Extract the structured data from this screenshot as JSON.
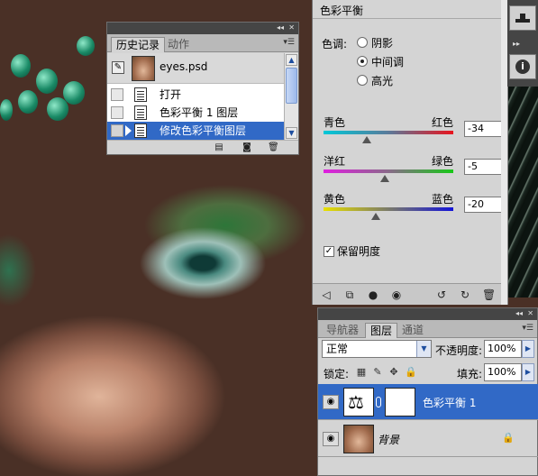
{
  "history_panel": {
    "tabs": [
      "历史记录",
      "动作"
    ],
    "snapshot_name": "eyes.psd",
    "states": [
      {
        "label": "打开",
        "selected": false
      },
      {
        "label": "色彩平衡 1 图层",
        "selected": false
      },
      {
        "label": "修改色彩平衡图层",
        "selected": true
      }
    ]
  },
  "color_balance_panel": {
    "title": "色彩平衡",
    "tone_label": "色调:",
    "tones": [
      {
        "label": "阴影",
        "selected": false
      },
      {
        "label": "中间调",
        "selected": true
      },
      {
        "label": "高光",
        "selected": false
      }
    ],
    "sliders": [
      {
        "left": "青色",
        "right": "红色",
        "value": "-34",
        "num": -34
      },
      {
        "left": "洋红",
        "right": "绿色",
        "value": "-5",
        "num": -5
      },
      {
        "left": "黄色",
        "right": "蓝色",
        "value": "-20",
        "num": -20
      }
    ],
    "preserve_luminosity": "保留明度",
    "preserve_checked": true
  },
  "layers_panel": {
    "tabs": [
      "导航器",
      "图层",
      "通道"
    ],
    "blend_mode": "正常",
    "opacity_label": "不透明度:",
    "opacity": "100%",
    "lock_label": "锁定:",
    "fill_label": "填充:",
    "fill": "100%",
    "layers": [
      {
        "name": "色彩平衡 1",
        "selected": true
      },
      {
        "name": "背景",
        "selected": false
      }
    ]
  },
  "colors": {
    "selection": "#3169c6",
    "panel_bg": "#d4d4d4",
    "titlebar": "#454545"
  }
}
